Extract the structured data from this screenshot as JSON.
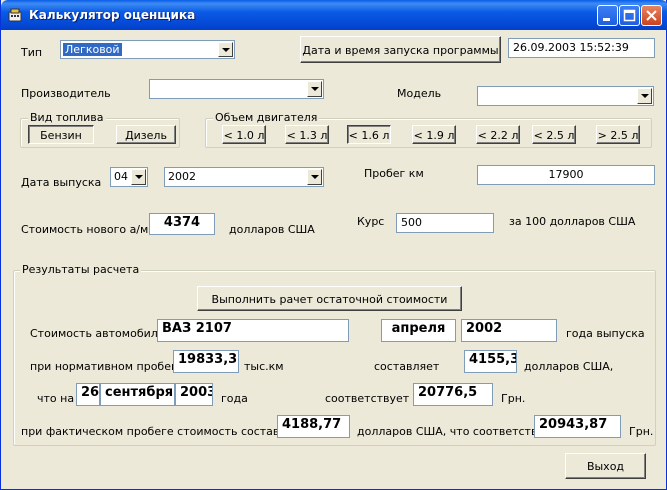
{
  "window": {
    "title": "Калькулятор оценщика"
  },
  "top": {
    "type_label": "Тип",
    "type_value": "Легковой",
    "launch_button": "Дата и время запуска программы",
    "launch_datetime": "26.09.2003 15:52:39"
  },
  "maker": {
    "label": "Производитель",
    "value": ""
  },
  "model": {
    "label": "Модель",
    "value": ""
  },
  "fuel": {
    "title": "Вид топлива",
    "petrol": "Бензин",
    "diesel": "Дизель"
  },
  "engine": {
    "title": "Объем двигателя",
    "options": [
      "< 1.0 л",
      "< 1.3 л",
      "< 1.6 л",
      "< 1.9 л",
      "< 2.2 л",
      "< 2.5 л",
      "> 2.5 л"
    ],
    "selected_index": 2
  },
  "release": {
    "label": "Дата выпуска",
    "month": "04",
    "year": "2002"
  },
  "mileage": {
    "label": "Пробег км",
    "value": "17900"
  },
  "new_cost": {
    "label": "Стоимость нового а/м",
    "value": "4374",
    "unit": "долларов США"
  },
  "rate": {
    "label": "Курс",
    "value": "500",
    "unit": "за 100 долларов США"
  },
  "results": {
    "title": "Результаты расчета",
    "calc_button": "Выполнить рачет остаточной стоимости",
    "car_cost_label": "Стоимость автомобиля",
    "car_name": "ВАЗ 2107",
    "car_month": "апреля",
    "car_year": "2002",
    "year_suffix": "года выпуска",
    "norm_label": "при нормативном пробеге",
    "norm_value": "19833,33",
    "norm_unit": "тыс.км",
    "amount_label": "составляет",
    "amount_usd": "4155,3",
    "amount_usd_unit": "долларов США,",
    "on_label": "что на",
    "on_day": "26",
    "on_month": "сентября",
    "on_year": "2003",
    "on_suffix": "года",
    "match_label": "соответствует",
    "match_uah": "20776,5",
    "uah_unit": "Грн.",
    "actual_label": "при фактическом пробеге стоимость составляет",
    "actual_usd": "4188,77",
    "actual_mid": "долларов США, что соответствует",
    "actual_uah": "20943,87",
    "actual_uah_unit": "Грн."
  },
  "exit_button": "Выход"
}
